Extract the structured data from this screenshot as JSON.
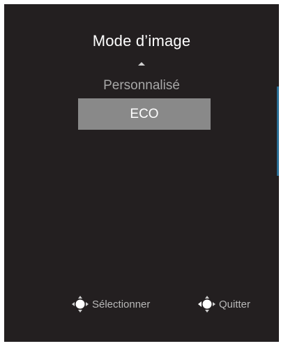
{
  "menu": {
    "title": "Mode d’image",
    "previous_option": "Personnalisé",
    "selected_option": "ECO"
  },
  "footer": {
    "select_label": "Sélectionner",
    "select_icon": "joystick-center-icon",
    "quit_label": "Quitter",
    "quit_icon": "joystick-left-icon"
  },
  "colors": {
    "background": "#231f20",
    "highlight": "#898989",
    "inactive_text": "#a7a7a7",
    "accent": "#2a6f97"
  }
}
